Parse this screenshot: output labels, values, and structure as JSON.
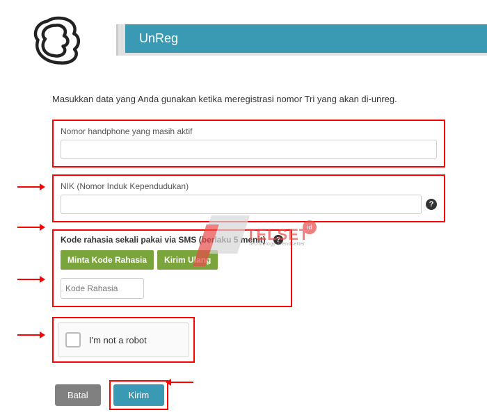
{
  "header": {
    "title": "UnReg"
  },
  "intro": "Masukkan data yang Anda gunakan ketika meregistrasi nomor Tri yang akan di-unreg.",
  "fields": {
    "phone": {
      "label": "Nomor handphone yang masih aktif",
      "value": ""
    },
    "nik": {
      "label": "NIK (Nomor Induk Kependudukan)",
      "value": ""
    }
  },
  "kode": {
    "heading": "Kode rahasia sekali pakai via SMS (berlaku 5 menit)",
    "request_btn": "Minta Kode Rahasia",
    "resend_btn": "Kirim Ulang",
    "placeholder": "Kode Rahasia"
  },
  "captcha": {
    "label": "I'm not a robot"
  },
  "actions": {
    "cancel": "Batal",
    "submit": "Kirim"
  },
  "watermark": {
    "brand": "TELSET",
    "badge": "id",
    "tagline": "Technology Trendsetter"
  }
}
